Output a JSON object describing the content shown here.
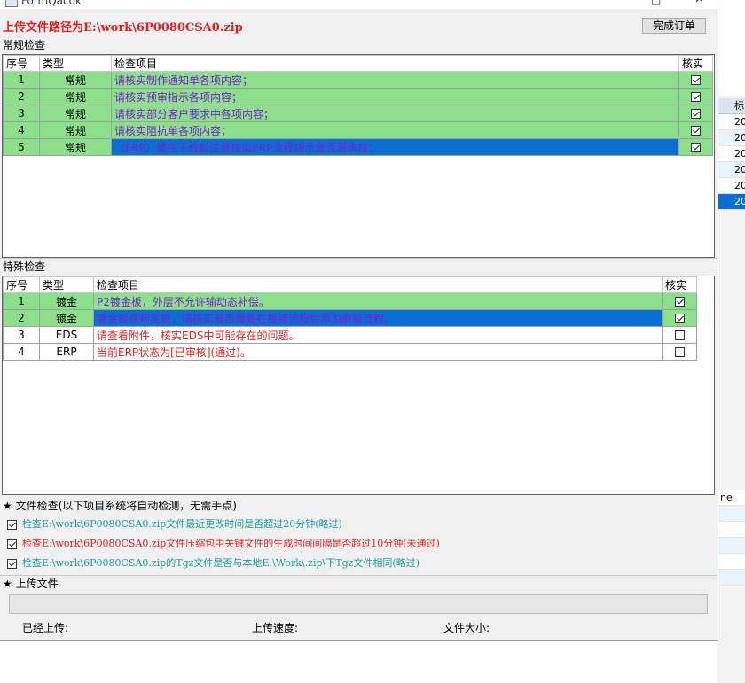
{
  "window": {
    "title": "FormQacok"
  },
  "upload_path": "上传文件路径为E:\\work\\6P0080CSA0.zip",
  "complete_button": "完成订单",
  "general": {
    "label": "常规检查",
    "headers": [
      "序号",
      "类型",
      "检查项目",
      "核实"
    ],
    "rows": [
      {
        "no": "1",
        "type": "常规",
        "item": "请核实制作通知单各项内容；",
        "checked": true
      },
      {
        "no": "2",
        "type": "常规",
        "item": "请核实预审指示各项内容；",
        "checked": true
      },
      {
        "no": "3",
        "type": "常规",
        "item": "请核实部分客户要求中各项内容；",
        "checked": true
      },
      {
        "no": "4",
        "type": "常规",
        "item": "请核实阻抗单各项内容；",
        "checked": true
      },
      {
        "no": "5",
        "type": "常规",
        "item": "（ERP）请在下线前注意核实ERP流程指示是否漏审核；",
        "checked": true
      }
    ]
  },
  "special": {
    "label": "特殊检查",
    "headers": [
      "序号",
      "类型",
      "检查项目",
      "核实"
    ],
    "rows": [
      {
        "no": "1",
        "type": "镀金",
        "item": "P2镀金板，外层不允许输动态补偿。",
        "checked": true
      },
      {
        "no": "2",
        "type": "镀金",
        "item": "镀金板或邦定板，请核实是否需要在板镀流程后添加磨板流程。",
        "checked": true
      },
      {
        "no": "3",
        "type": "EDS",
        "item": "请查看附件，核实EDS中可能存在的问题。",
        "checked": false
      },
      {
        "no": "4",
        "type": "ERP",
        "item": "当前ERP状态为[已审核](通过)。",
        "checked": false
      }
    ]
  },
  "file_check": {
    "header": "★ 文件检查(以下项目系统将自动检测，无需手点)",
    "items": [
      {
        "text": "检查E:\\work\\6P0080CSA0.zip文件最近更改时间是否超过20分钟(略过)",
        "checked": true,
        "color": "#1a9c9c"
      },
      {
        "text": "检查E:\\work\\6P0080CSA0.zip文件压缩包中关键文件的生成时间间隔是否超过10分钟(未通过)",
        "checked": true,
        "color": "#e41e1e"
      },
      {
        "text": "检查E:\\work\\6P0080CSA0.zip的Tgz文件是否与本地E:\\Work\\.zip\\下Tgz文件相同(略过)",
        "checked": true,
        "color": "#1a9c9c"
      }
    ]
  },
  "upload": {
    "header": "★ 上传文件",
    "progress": 0,
    "uploaded_label": "已经上传:",
    "speed_label": "上传速度:",
    "size_label": "文件大小:"
  },
  "background_app": {
    "header": "标",
    "rows": [
      "20",
      "20",
      "20",
      "20",
      "20",
      "20"
    ],
    "header2": "ne",
    "colors": {
      "selected": "#0a6fd1",
      "alt": "#e8f3fb"
    }
  },
  "colors": {
    "row_green": "#8ce08c",
    "selection": "#0a6fd1",
    "error_red": "#e41e1e",
    "skip_teal": "#1a9c9c",
    "purple_text": "#7a1fcf"
  }
}
